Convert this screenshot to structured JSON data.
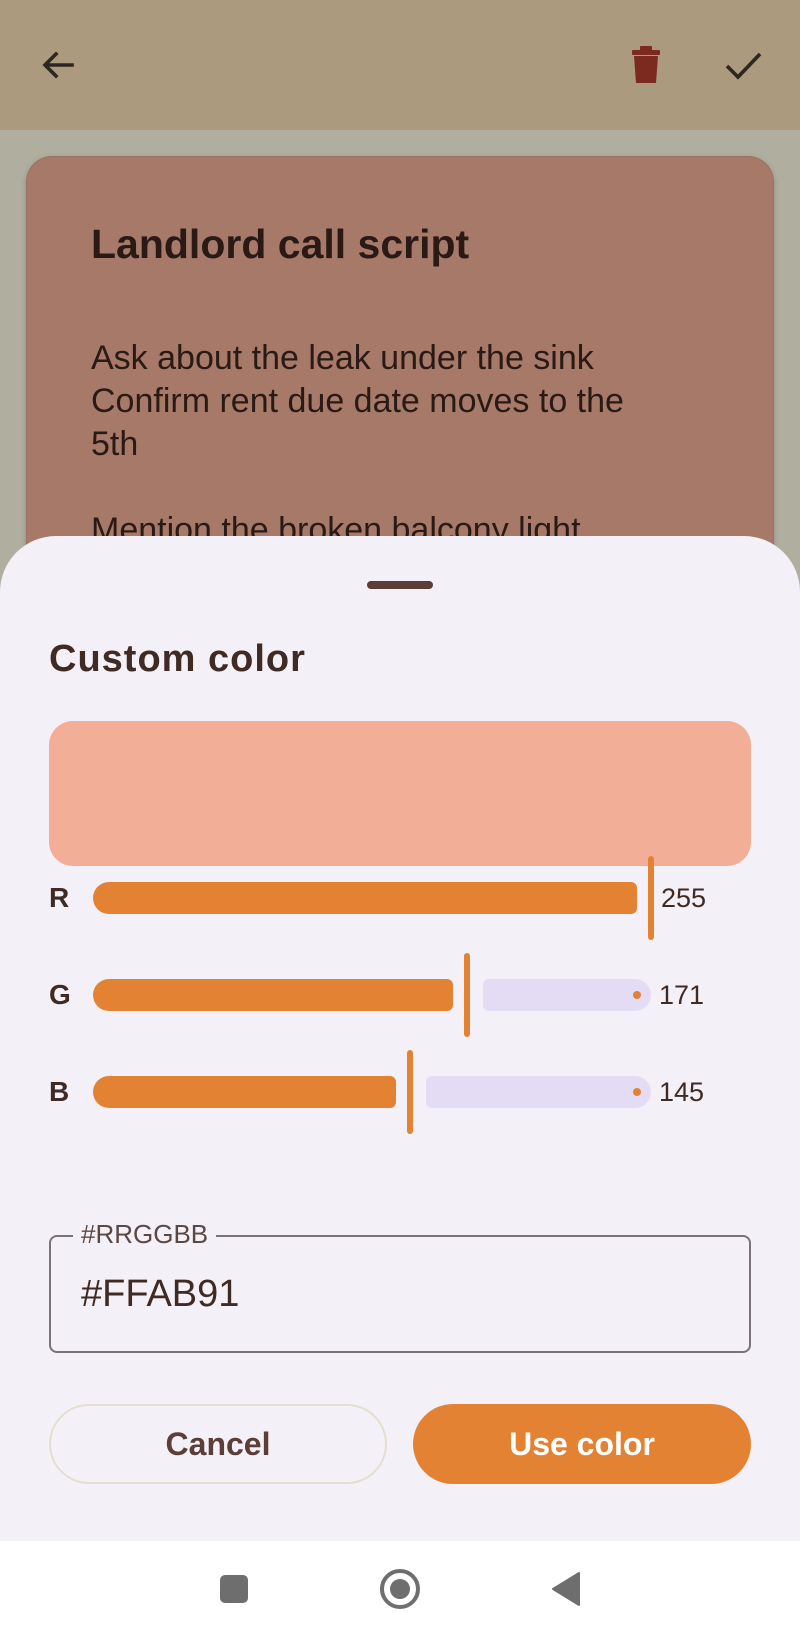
{
  "toolbar": {
    "back_icon": "arrow-back-icon",
    "delete_icon": "trash-icon",
    "save_icon": "check-icon",
    "colors": {
      "bar": "#ab9a7e",
      "delete": "#7c2a20",
      "icon": "#2e2620"
    }
  },
  "note": {
    "title": "Landlord call script",
    "lines": [
      "Ask about the leak under the sink",
      "Confirm rent due date moves to the",
      "5th",
      "",
      "Mention the broken balcony light"
    ],
    "color": "#a67968"
  },
  "sheet": {
    "title": "Custom color",
    "preview_color": "#f2ae96",
    "sliders": [
      {
        "label": "R",
        "value": 255,
        "max": 255,
        "display": "255"
      },
      {
        "label": "G",
        "value": 171,
        "max": 255,
        "display": "171"
      },
      {
        "label": "B",
        "value": 145,
        "max": 255,
        "display": "145"
      }
    ],
    "hex_field": {
      "label": "#RRGGBB",
      "value": "#FFAB91"
    },
    "cancel_label": "Cancel",
    "confirm_label": "Use color",
    "accent": "#e48233",
    "inactive_track": "#e4dcf4"
  },
  "navbar": {
    "recents_icon": "square-icon",
    "home_icon": "circle-home-icon",
    "back_icon": "triangle-back-icon"
  }
}
